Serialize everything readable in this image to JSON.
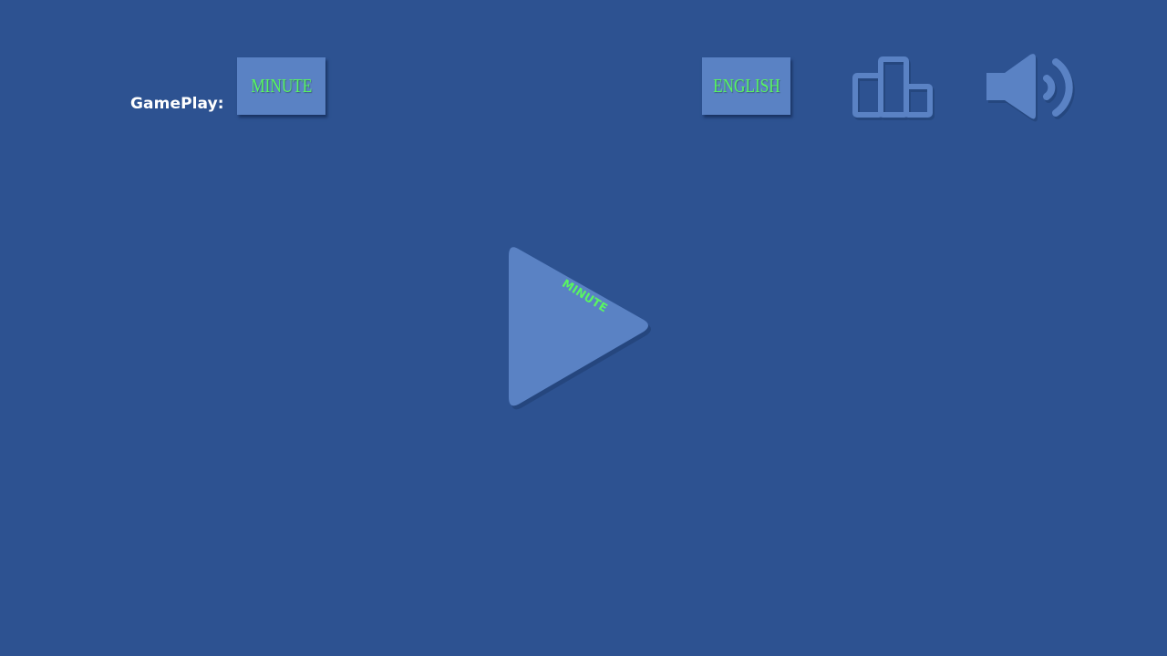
{
  "gameplay": {
    "label": "GamePlay:",
    "mode_button_label": "MINUTE"
  },
  "language": {
    "button_label": "ENGLISH"
  },
  "play": {
    "mode_label": "MINUTE"
  },
  "icons": {
    "leaderboard": "podium-icon",
    "sound": "speaker-volume-icon",
    "play": "play-triangle-icon"
  },
  "colors": {
    "background": "#2d5291",
    "tile": "#5a82c4",
    "label_green": "#59f562",
    "text_white": "#ffffff"
  }
}
